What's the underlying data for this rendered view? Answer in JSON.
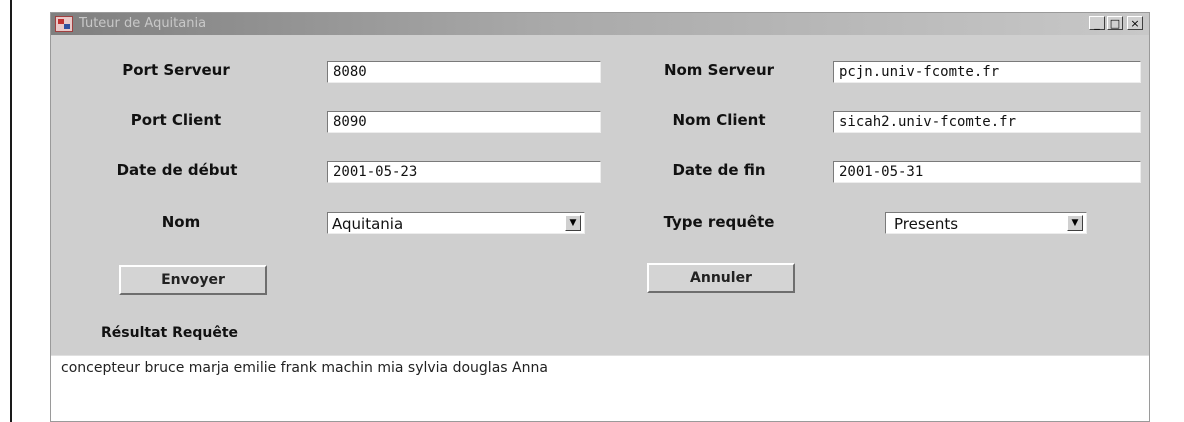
{
  "window": {
    "title": "Tuteur de Aquitania",
    "controls": {
      "minimize": "_",
      "maximize": "□",
      "close": "×"
    }
  },
  "form": {
    "port_serveur": {
      "label": "Port Serveur",
      "value": "8080"
    },
    "nom_serveur": {
      "label": "Nom Serveur",
      "value": "pcjn.univ-fcomte.fr"
    },
    "port_client": {
      "label": "Port Client",
      "value": "8090"
    },
    "nom_client": {
      "label": "Nom Client",
      "value": "sicah2.univ-fcomte.fr"
    },
    "date_debut": {
      "label": "Date de début",
      "value": "2001-05-23"
    },
    "date_fin": {
      "label": "Date de fin",
      "value": "2001-05-31"
    },
    "nom": {
      "label": "Nom",
      "selected": "Aquitania"
    },
    "type_requete": {
      "label": "Type requête",
      "selected": "Presents"
    }
  },
  "actions": {
    "envoyer": "Envoyer",
    "annuler": "Annuler"
  },
  "result": {
    "label": "Résultat Requête",
    "text": "concepteur bruce marja emilie frank machin mia sylvia douglas Anna"
  },
  "icons": {
    "dropdown": "▼"
  }
}
